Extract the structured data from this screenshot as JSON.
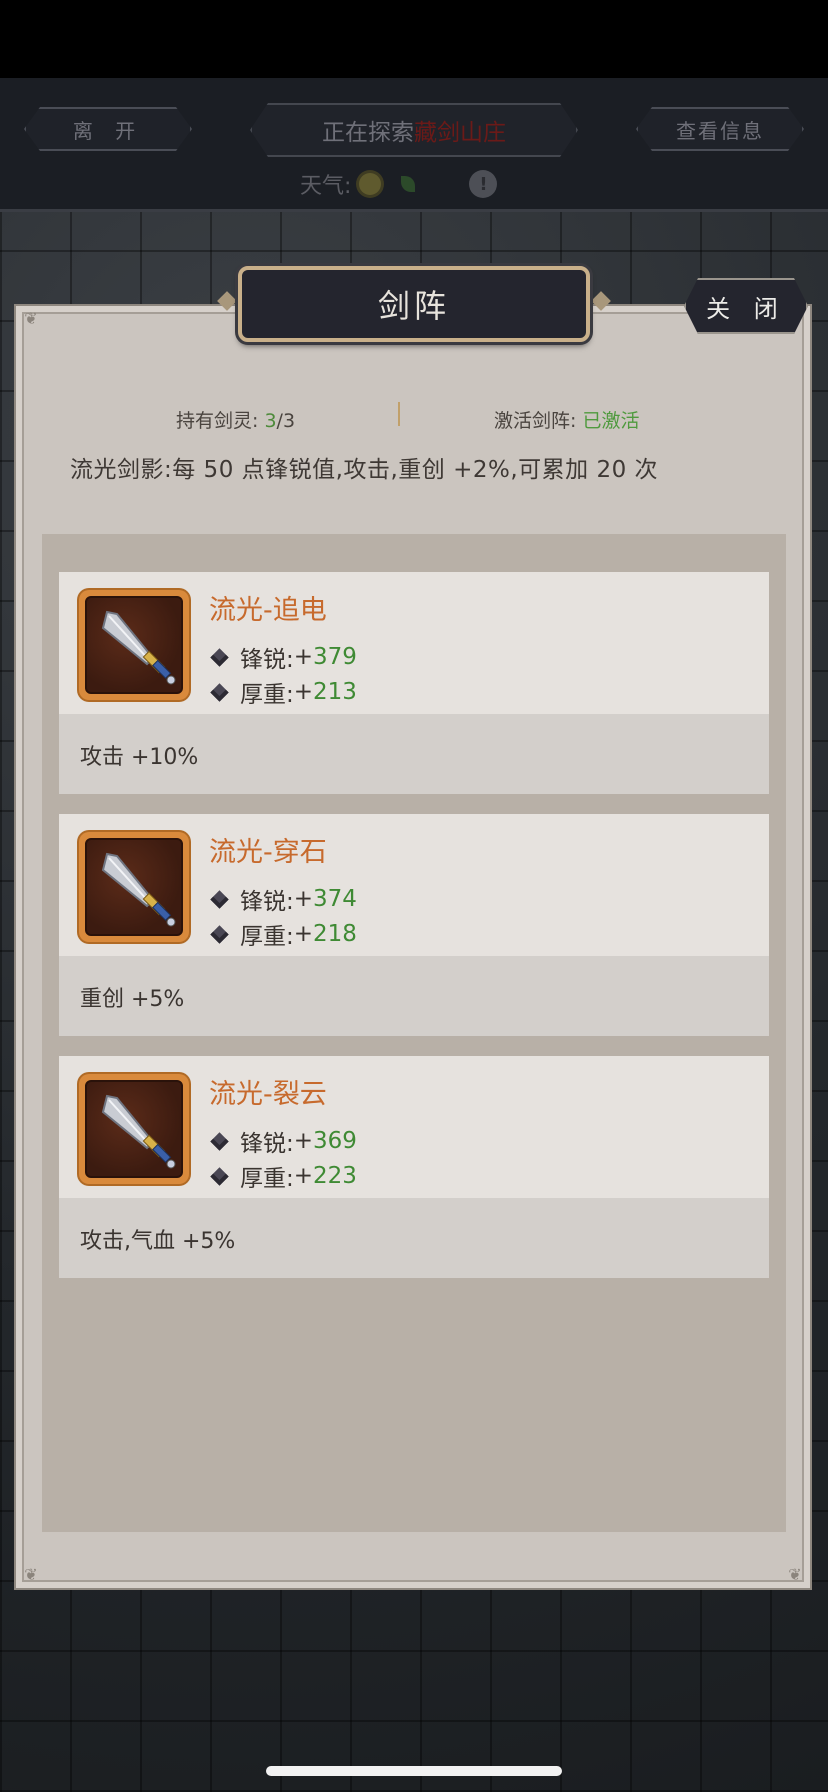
{
  "topbar": {
    "leave_label": "离 开",
    "info_label": "查看信息",
    "explore_prefix": "正在探索",
    "explore_place": "藏剑山庄",
    "weather_label": "天气:",
    "weather_icons": [
      "sun-icon",
      "leaf-icon",
      "warning-icon"
    ],
    "warning_glyph": "!"
  },
  "modal": {
    "title": "剑阵",
    "close_label": "关 闭",
    "hold_label": "持有剑灵:",
    "hold_count": "3",
    "hold_total": "/3",
    "active_label": "激活剑阵:",
    "active_value": "已激活",
    "effect_text": "流光剑影:每 50 点锋锐值,攻击,重创 +2%,可累加 20 次"
  },
  "cards": [
    {
      "name": "流光-追电",
      "attr1_label": "锋锐:",
      "attr1_value": "379",
      "attr2_label": "厚重:",
      "attr2_value": "213",
      "bonus": "攻击 +10%"
    },
    {
      "name": "流光-穿石",
      "attr1_label": "锋锐:",
      "attr1_value": "374",
      "attr2_label": "厚重:",
      "attr2_value": "218",
      "bonus": "重创 +5%"
    },
    {
      "name": "流光-裂云",
      "attr1_label": "锋锐:",
      "attr1_value": "369",
      "attr2_label": "厚重:",
      "attr2_value": "223",
      "bonus": "攻击,气血 +5%"
    }
  ],
  "colors": {
    "accent_orange": "#c76a2d",
    "value_green": "#3f8a34",
    "explore_red": "#6b1a18"
  }
}
